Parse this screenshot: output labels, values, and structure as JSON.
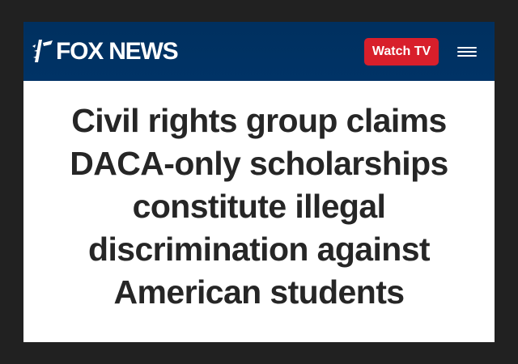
{
  "header": {
    "logo_text": "FOX NEWS",
    "logo_icon": "fox-news-logo-icon",
    "watch_button_label": "Watch TV",
    "menu_icon": "hamburger-menu-icon"
  },
  "headline": {
    "lines": [
      "Civil rights group claims",
      "DACA-only scholarships",
      "constitute illegal",
      "discrimination against",
      "American students"
    ]
  },
  "colors": {
    "header_bg": "#003366",
    "button_bg": "#d81f2b",
    "headline_text": "#262626",
    "outer_bg": "#212121"
  }
}
